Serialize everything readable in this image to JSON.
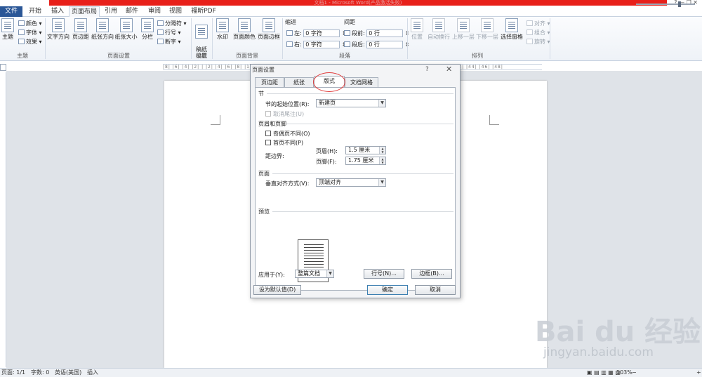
{
  "window": {
    "title": "文档1 - Microsoft Word(产品激活失败)",
    "controls": "?  —  ❐  ✕"
  },
  "tabs": [
    {
      "label": "文件"
    },
    {
      "label": "开始"
    },
    {
      "label": "插入"
    },
    {
      "label": "页面布局"
    },
    {
      "label": "引用"
    },
    {
      "label": "邮件"
    },
    {
      "label": "审阅"
    },
    {
      "label": "视图"
    },
    {
      "label": "福昕PDF"
    }
  ],
  "ribbon": {
    "theme": {
      "big": "主题",
      "colors": "颜色",
      "fonts": "字体",
      "effects": "效果",
      "group": "主题"
    },
    "page_setup": {
      "text_direction": "文字方向",
      "margins": "页边距",
      "orientation": "纸张方向",
      "size": "纸张大小",
      "columns": "分栏",
      "breaks": "分隔符",
      "line_numbers": "行号",
      "hyphenation": "断字",
      "group": "页面设置"
    },
    "draft": {
      "label": "稿纸\n设置",
      "group": "稿纸"
    },
    "background": {
      "watermark": "水印",
      "page_color": "页面颜色",
      "page_borders": "页面边框",
      "group": "页面背景"
    },
    "paragraph": {
      "indent": "缩进",
      "left": "左:",
      "left_val": "0 字符",
      "right": "右:",
      "right_val": "0 字符",
      "spacing": "间距",
      "before": "段前:",
      "before_val": "0 行",
      "after": "段后:",
      "after_val": "0 行",
      "group": "段落"
    },
    "arrange": {
      "position": "位置",
      "wrap": "自动换行",
      "forward": "上移一层",
      "backward": "下移一层",
      "selection_pane": "选择窗格",
      "align": "对齐",
      "group_btn": "组合",
      "rotate": "旋转",
      "group": "排列"
    }
  },
  "ruler": {
    "marks": "|8| |6| |4| |2| | |2| |4| |6| |8| |10| |12| |14| |16| |18| |20| |22| |24| |26| |28| |30| |32| |34| |36| |38| |40| |42| |44| |46| |48|"
  },
  "dialog": {
    "title": "页面设置",
    "help": "?",
    "close": "✕",
    "tabs": [
      "页边距",
      "纸张",
      "版式",
      "文档网格"
    ],
    "section_label": "节",
    "section_start_label": "节的起始位置(R):",
    "section_start_value": "新建页",
    "suppress_endnotes": "取消尾注(U)",
    "header_footer_label": "页眉和页脚",
    "odd_even": "奇偶页不同(O)",
    "first_page": "首页不同(P)",
    "from_edge": "距边界:",
    "header_label": "页眉(H):",
    "header_value": "1.5 厘米",
    "footer_label": "页脚(F):",
    "footer_value": "1.75 厘米",
    "page_label": "页面",
    "valign_label": "垂直对齐方式(V):",
    "valign_value": "顶端对齐",
    "preview_label": "预览",
    "apply_label": "应用于(Y):",
    "apply_value": "整篇文档",
    "line_numbers_btn": "行号(N)...",
    "borders_btn": "边框(B)...",
    "default_btn": "设为默认值(D)",
    "ok_btn": "确定",
    "cancel_btn": "取消"
  },
  "status": {
    "page": "页面: 1/1",
    "words": "字数: 0",
    "lang": "英语(美国)",
    "mode": "插入",
    "zoom": "103%",
    "minus": "−",
    "plus": "+"
  },
  "watermark": {
    "logo": "Bai du 经验",
    "url": "jingyan.baidu.com"
  }
}
